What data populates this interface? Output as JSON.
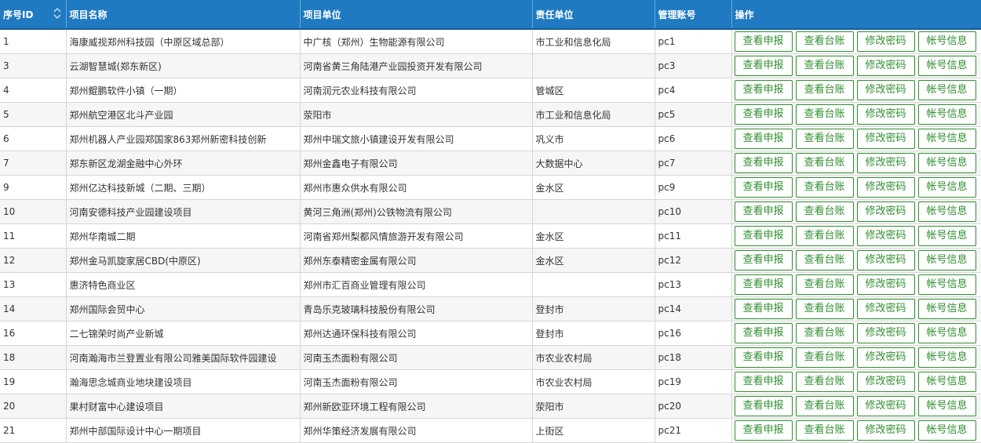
{
  "headers": {
    "id": "序号ID",
    "name": "项目名称",
    "unit": "项目单位",
    "resp": "责任单位",
    "account": "管理账号",
    "ops": "操作"
  },
  "buttons": {
    "view_report": "查看申报",
    "view_ledger": "查看台账",
    "change_password": "修改密码",
    "account_info": "帐号信息"
  },
  "colors": {
    "header_bg": "#1f7ac1",
    "button_green": "#2f8f2f"
  },
  "icons": {
    "sort": "sort-icon"
  },
  "rows": [
    {
      "id": "1",
      "name": "海康威视郑州科技园（中原区域总部）",
      "unit": "中广核（郑州）生物能源有限公司",
      "resp": "市工业和信息化局",
      "account": "pc1"
    },
    {
      "id": "3",
      "name": "云湖智慧城(郑东新区)",
      "unit": "河南省黄三角陆港产业园投资开发有限公司",
      "resp": "",
      "account": "pc3"
    },
    {
      "id": "4",
      "name": "郑州鲲鹏软件小镇（一期）",
      "unit": "河南润元农业科技有限公司",
      "resp": "管城区",
      "account": "pc4"
    },
    {
      "id": "5",
      "name": "郑州航空港区北斗产业园",
      "unit": "荥阳市",
      "resp": "市工业和信息化局",
      "account": "pc5"
    },
    {
      "id": "6",
      "name": "郑州机器人产业园郑国家863郑州新密科技创新",
      "unit": "郑州中瑞文旅小镇建设开发有限公司",
      "resp": "巩义市",
      "account": "pc6"
    },
    {
      "id": "7",
      "name": "郑东新区龙湖金融中心外环",
      "unit": "郑州金鑫电子有限公司",
      "resp": "大数据中心",
      "account": "pc7"
    },
    {
      "id": "9",
      "name": "郑州亿达科技新城（二期、三期）",
      "unit": "郑州市惠众供水有限公司",
      "resp": "金水区",
      "account": "pc9"
    },
    {
      "id": "10",
      "name": "河南安德科技产业园建设项目",
      "unit": "黄河三角洲(郑州)公铁物流有限公司",
      "resp": "",
      "account": "pc10"
    },
    {
      "id": "11",
      "name": "郑州华南城二期",
      "unit": "河南省郑州梨都风情旅游开发有限公司",
      "resp": "金水区",
      "account": "pc11"
    },
    {
      "id": "12",
      "name": "郑州金马凯旋家居CBD(中原区)",
      "unit": "郑州东泰精密金属有限公司",
      "resp": "金水区",
      "account": "pc12"
    },
    {
      "id": "13",
      "name": "惠济特色商业区",
      "unit": "郑州市汇百商业管理有限公司",
      "resp": "",
      "account": "pc13"
    },
    {
      "id": "14",
      "name": "郑州国际会贸中心",
      "unit": "青岛乐克玻璃科技股份有限公司",
      "resp": "登封市",
      "account": "pc14"
    },
    {
      "id": "16",
      "name": "二七锦荣时尚产业新城",
      "unit": "郑州达通环保科技有限公司",
      "resp": "登封市",
      "account": "pc16"
    },
    {
      "id": "18",
      "name": "河南瀚海市兰登置业有限公司雅美国际软件园建设",
      "unit": "河南玉杰面粉有限公司",
      "resp": "市农业农村局",
      "account": "pc18"
    },
    {
      "id": "19",
      "name": "瀚海思念城商业地块建设项目",
      "unit": "河南玉杰面粉有限公司",
      "resp": "市农业农村局",
      "account": "pc19"
    },
    {
      "id": "20",
      "name": "果村财富中心建设项目",
      "unit": "郑州新欧亚环境工程有限公司",
      "resp": "荥阳市",
      "account": "pc20"
    },
    {
      "id": "21",
      "name": "郑州中部国际设计中心一期项目",
      "unit": "郑州华策经济发展有限公司",
      "resp": "上街区",
      "account": "pc21"
    }
  ]
}
